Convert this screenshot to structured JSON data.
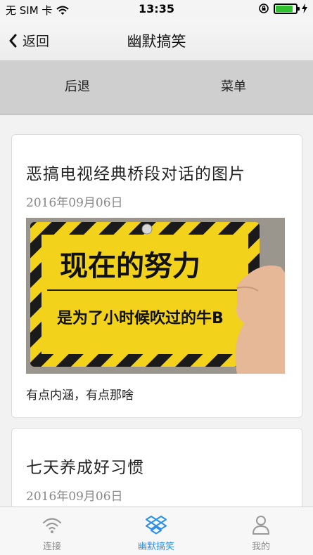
{
  "status_bar": {
    "carrier": "无 SIM 卡",
    "time": "13:35",
    "battery_level": 0.85
  },
  "nav": {
    "back_label": "返回",
    "title": "幽默搞笑"
  },
  "sub_menu": {
    "back_label": "后退",
    "menu_label": "菜单"
  },
  "articles": [
    {
      "title": "恶搞电视经典桥段对话的图片",
      "date": "2016年09月06日",
      "image": {
        "line1": "现在的努力",
        "line2": "是为了小时候吹过的牛B"
      },
      "description": "有点内涵，有点那啥"
    },
    {
      "title": "七天养成好习惯",
      "date": "2016年09月06日"
    }
  ],
  "tabs": [
    {
      "label": "连接",
      "icon": "wifi-icon",
      "active": false
    },
    {
      "label": "幽默搞笑",
      "icon": "dropbox-icon",
      "active": true
    },
    {
      "label": "我的",
      "icon": "user-icon",
      "active": false
    }
  ],
  "colors": {
    "accent": "#2b8ee8",
    "sign_yellow": "#f2d21a",
    "hazard_black": "#1a1a1a"
  }
}
